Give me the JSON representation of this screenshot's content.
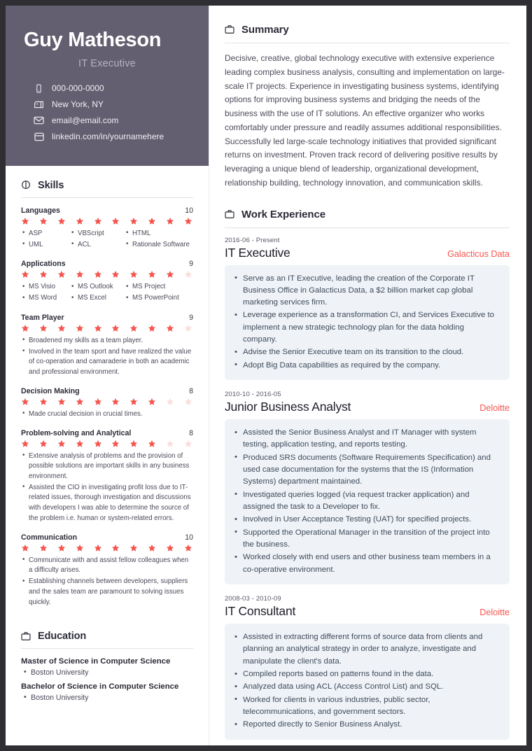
{
  "identity": {
    "name": "Guy Matheson",
    "title": "IT Executive",
    "contacts": [
      {
        "icon": "phone-icon",
        "text": "000-000-0000"
      },
      {
        "icon": "mailbox-icon",
        "text": "New York, NY"
      },
      {
        "icon": "envelope-icon",
        "text": "email@email.com"
      },
      {
        "icon": "browser-window-icon",
        "text": "linkedin.com/in/yournamehere"
      }
    ]
  },
  "sidebar": {
    "skills_section": {
      "title": "Skills",
      "icon": "circle-line-icon",
      "max_rating": 10,
      "skills": [
        {
          "name": "Languages",
          "score": 10,
          "columns": true,
          "bullets": [
            "ASP",
            "UML",
            "VBScript",
            "ACL",
            "HTML",
            "Rationale Software"
          ]
        },
        {
          "name": "Applications",
          "score": 9,
          "columns": true,
          "bullets": [
            "MS Visio",
            "MS Word",
            "MS Outlook",
            "MS Excel",
            "MS Project",
            "MS PowerPoint"
          ]
        },
        {
          "name": "Team Player",
          "score": 9,
          "columns": false,
          "bullets": [
            "Broadened my skills as a team player.",
            "Involved in the team sport and have realized the value of co-operation and camaraderie in both an academic and professional environment."
          ]
        },
        {
          "name": "Decision Making",
          "score": 8,
          "columns": false,
          "bullets": [
            "Made crucial decision in crucial times."
          ]
        },
        {
          "name": "Problem-solving and Analytical",
          "score": 8,
          "columns": false,
          "bullets": [
            "Extensive analysis of problems and the provision of possible solutions are important skills in any business environment.",
            "Assisted the CIO in investigating profit loss due to IT-related issues, thorough investigation and discussions with developers I was able to determine the source of the problem i.e. human or system-related errors."
          ]
        },
        {
          "name": "Communication",
          "score": 10,
          "columns": false,
          "bullets": [
            "Communicate with and assist fellow colleagues when a difficulty arises.",
            "Establishing channels between developers, suppliers and the sales team are paramount to solving issues quickly."
          ]
        }
      ]
    },
    "education_section": {
      "title": "Education",
      "icon": "briefcase-icon",
      "items": [
        {
          "degree": "Master of Science in Computer Science",
          "school": "Boston University"
        },
        {
          "degree": "Bachelor of Science in Computer Science",
          "school": "Boston University"
        }
      ]
    }
  },
  "main": {
    "summary_section": {
      "title": "Summary",
      "icon": "briefcase-icon",
      "text": "Decisive, creative, global technology executive with extensive experience leading complex business analysis, consulting and implementation on large-scale IT projects. Experience in investigating business systems, identifying options for improving business systems and bridging the needs of the business with the use of IT solutions. An effective organizer who works comfortably under pressure and readily assumes additional responsibilities. Successfully led large-scale technology initiatives that provided significant returns on investment. Proven track record of delivering positive results by leveraging a unique blend of leadership, organizational development, relationship building, technology innovation, and communication skills."
    },
    "work_section": {
      "title": "Work Experience",
      "icon": "briefcase-icon",
      "jobs": [
        {
          "date": "2016-06 - Present",
          "role": "IT Executive",
          "company": "Galacticus Data",
          "bullets": [
            "Serve as an IT Executive, leading the creation of the Corporate IT Business Office in Galacticus Data, a $2 billion market cap global marketing services firm.",
            "Leverage experience as a transformation CI, and Services Executive to implement a new strategic technology plan for the data holding company.",
            "Advise the Senior Executive team on its transition to the cloud.",
            "Adopt Big Data capabilities as required by the company."
          ]
        },
        {
          "date": "2010-10 - 2016-05",
          "role": "Junior Business Analyst",
          "company": "Deloitte",
          "bullets": [
            "Assisted the Senior Business Analyst and IT Manager with system testing, application testing, and reports testing.",
            "Produced SRS documents (Software Requirements Specification) and used case documentation for the systems that the IS (Information Systems) department maintained.",
            "Investigated queries logged (via request tracker application) and assigned the task to a Developer to fix.",
            "Involved in User Acceptance Testing (UAT) for specified projects.",
            "Supported the Operational Manager in the transition of the project into the business.",
            "Worked closely with end users and other business team members in a co-operative environment."
          ]
        },
        {
          "date": "2008-03 - 2010-09",
          "role": "IT Consultant",
          "company": "Deloitte",
          "bullets": [
            "Assisted in extracting different forms of source data from clients and planning an analytical strategy in order to analyze, investigate and manipulate the client's data.",
            "Compiled reports based on patterns found in the data.",
            "Analyzed data using ACL (Access Control List) and SQL.",
            "Worked for clients in various industries, public sector, telecommunications, and government sectors.",
            "Reported directly to Senior Business Analyst."
          ]
        }
      ]
    }
  },
  "colors": {
    "sidebar_header_bg": "#645f70",
    "accent": "#f5564e",
    "star_filled": "#f5564e",
    "star_empty": "#fadedc",
    "panel_bg": "#eff3f7",
    "page_bg": "#ffffff",
    "outer_bg": "#2e2e33"
  }
}
